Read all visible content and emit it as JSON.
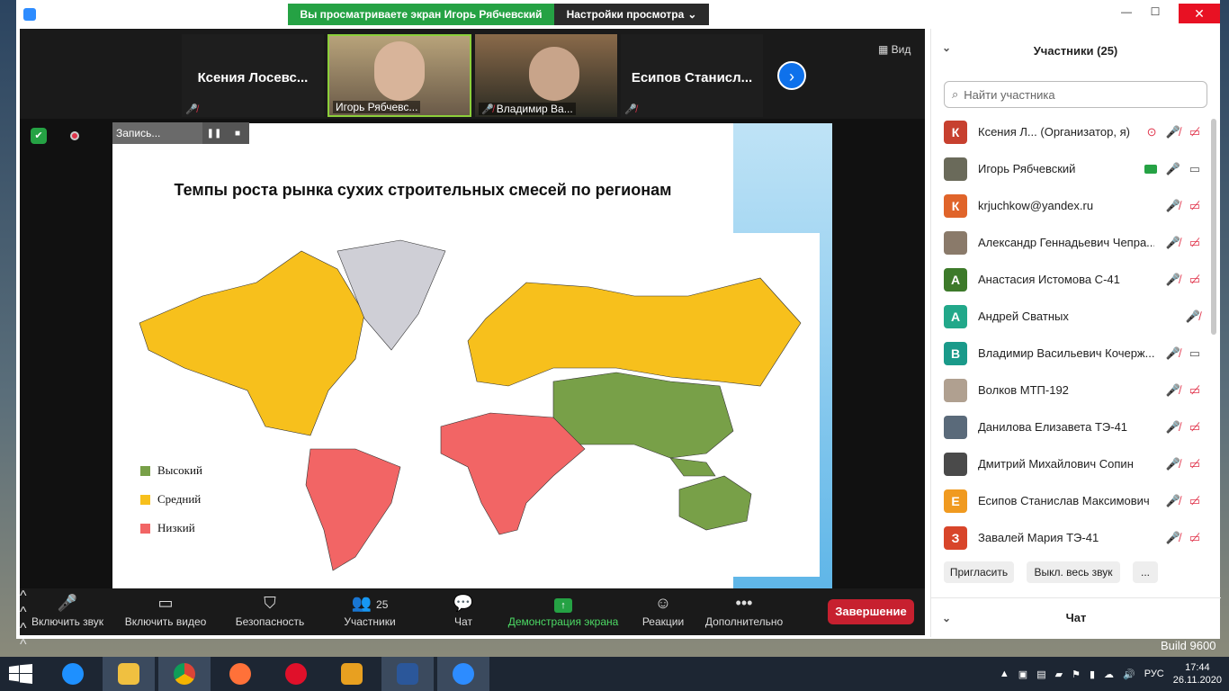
{
  "share_banner": {
    "viewing": "Вы просматриваете экран Игорь Рябчевский",
    "view_settings": "Настройки просмотра"
  },
  "gallery": {
    "tiles": [
      {
        "name": "Ксения  Лосевс...",
        "video": false
      },
      {
        "name": "Игорь Рябчевс...",
        "video": true
      },
      {
        "name": "Владимир Ва...",
        "video": true
      },
      {
        "name": "Есипов  Станисл...",
        "video": false
      }
    ],
    "view_label": "Вид"
  },
  "recording": {
    "label": "Запись..."
  },
  "slide": {
    "title": "Темпы роста рынка сухих строительных смесей по регионам",
    "legend": [
      {
        "label": "Высокий",
        "color": "#78a048"
      },
      {
        "label": "Средний",
        "color": "#f7c01c"
      },
      {
        "label": "Низкий",
        "color": "#f26565"
      }
    ]
  },
  "toolbar": {
    "unmute": "Включить звук",
    "start_video": "Включить видео",
    "security": "Безопасность",
    "participants": "Участники",
    "participants_count": "25",
    "chat": "Чат",
    "share": "Демонстрация экрана",
    "reactions": "Реакции",
    "more": "Дополнительно",
    "end": "Завершение"
  },
  "panel": {
    "title": "Участники (25)",
    "search_placeholder": "Найти участника",
    "participants": [
      {
        "initial": "К",
        "color": "#c7402f",
        "name": "Ксения Л...  (Организатор, я)",
        "status": "host"
      },
      {
        "initial": "",
        "color": "#6a6a5a",
        "name": "Игорь Рябчевский",
        "status": "sharing"
      },
      {
        "initial": "К",
        "color": "#e0642a",
        "name": "krjuchkow@yandex.ru",
        "status": "muted"
      },
      {
        "initial": "",
        "color": "#8a7a6a",
        "name": "Александр Геннадьевич Чепра...",
        "status": "muted"
      },
      {
        "initial": "А",
        "color": "#3d7a2a",
        "name": "Анастасия Истомова С-41",
        "status": "muted"
      },
      {
        "initial": "А",
        "color": "#22a88a",
        "name": "Андрей Сватных",
        "status": "mic-only"
      },
      {
        "initial": "В",
        "color": "#1a9a8a",
        "name": "Владимир Васильевич Кочерж...",
        "status": "muted-video"
      },
      {
        "initial": "",
        "color": "#b0a090",
        "name": "Волков МТП-192",
        "status": "muted"
      },
      {
        "initial": "",
        "color": "#5a6a7a",
        "name": "Данилова Елизавета ТЭ-41",
        "status": "muted"
      },
      {
        "initial": "",
        "color": "#4a4a4a",
        "name": "Дмитрий Михайлович Сопин",
        "status": "muted"
      },
      {
        "initial": "Е",
        "color": "#f09a20",
        "name": "Есипов Станислав Максимович",
        "status": "muted"
      },
      {
        "initial": "З",
        "color": "#d8452a",
        "name": "Завалей Мария ТЭ-41",
        "status": "muted"
      }
    ],
    "invite": "Пригласить",
    "mute_all": "Выкл. весь звук",
    "more": "...",
    "chat_title": "Чат"
  },
  "desktop": {
    "build": "Build 9600"
  },
  "taskbar": {
    "lang": "РУС",
    "time": "17:44",
    "date": "26.11.2020"
  }
}
